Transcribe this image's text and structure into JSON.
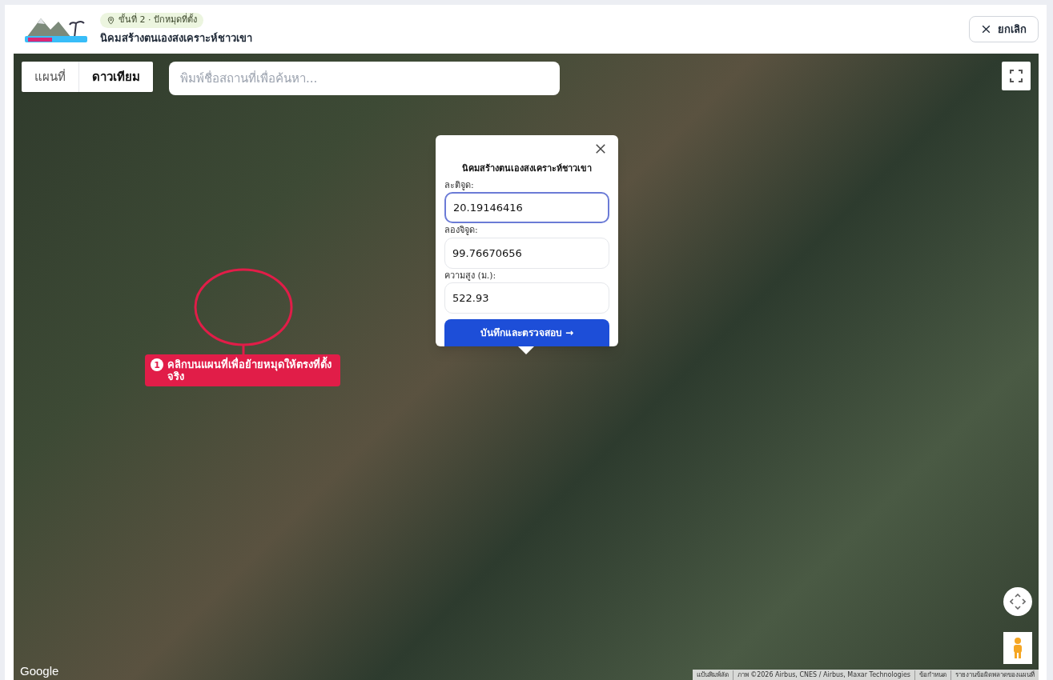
{
  "header": {
    "step_badge": "ขั้นที่ 2 · ปักหมุดที่ตั้ง",
    "title": "นิคมสร้างตนเองสงเคราะห์ชาวเขา",
    "cancel_button": "ยกเลิก"
  },
  "map": {
    "type_tabs": [
      {
        "label": "แผนที่",
        "selected": false
      },
      {
        "label": "ดาวเทียม",
        "selected": true
      }
    ],
    "search": {
      "placeholder": "พิมพ์ชื่อสถานที่เพื่อค้นหา..."
    },
    "hint": {
      "number": "1",
      "text": "คลิกบนแผนที่เพื่อย้ายหมุดให้ตรงที่ตั้งจริง"
    },
    "popup": {
      "title": "นิคมสร้างตนเองสงเคราะห์ชาวเขา",
      "fields": [
        {
          "label": "ละติจูด:",
          "value": "20.19146416",
          "focused": true
        },
        {
          "label": "ลองจิจูด:",
          "value": "99.76670656",
          "focused": false
        },
        {
          "label": "ความสูง (ม.):",
          "value": "522.93",
          "focused": false
        }
      ],
      "submit_button": "บันทึกและตรวจสอบ →"
    },
    "logo": "Google",
    "attribution": [
      "แป้นพิมพ์ลัด",
      "ภาพ ©2026 Airbus, CNES / Airbus, Maxar Technologies",
      "ข้อกำหนด",
      "รายงานข้อผิดพลาดของแผนที่"
    ]
  }
}
